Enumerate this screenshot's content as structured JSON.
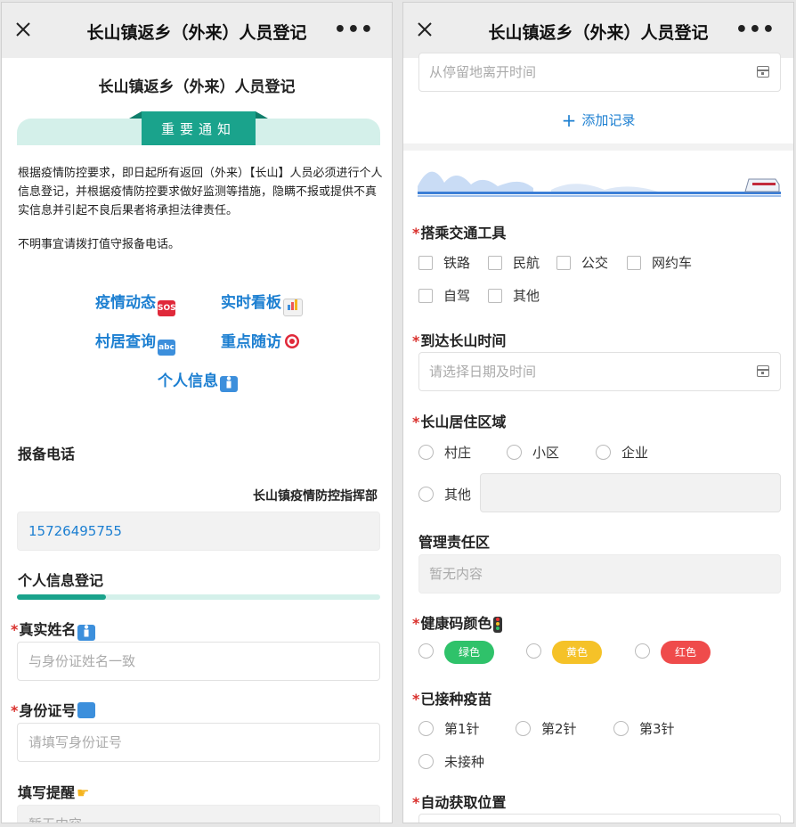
{
  "left": {
    "window_title": "长山镇返乡（外来）人员登记",
    "form_title": "长山镇返乡（外来）人员登记",
    "notice_tab": "重要通知",
    "notice_p1": "根据疫情防控要求，即日起所有返回（外来）【长山】人员必须进行个人信息登记，并根据疫情防控要求做好监测等措施，隐瞒不报或提供不真实信息并引起不良后果者将承担法律责任。",
    "notice_p2": "不明事宜请拨打值守报备电话。",
    "links": {
      "epidemic": "疫情动态",
      "realtime": "实时看板",
      "village": "村居查询",
      "followup": "重点随访",
      "personal": "个人信息"
    },
    "emoji": {
      "sos": "SOS",
      "chart": "",
      "abc": "abc",
      "target": "",
      "person": ""
    },
    "report_phone_label": "报备电话",
    "hq_name": "长山镇疫情防控指挥部",
    "phone": "15726495755",
    "section_title": "个人信息登记",
    "name_label": "真实姓名",
    "name_placeholder": "与身份证姓名一致",
    "id_label": "身份证号",
    "id_placeholder": "请填写身份证号",
    "reminder_label": "填写提醒",
    "reminder_placeholder": "暂无内容"
  },
  "right": {
    "window_title": "长山镇返乡（外来）人员登记",
    "leave_time_placeholder": "从停留地离开时间",
    "add_record": "添加记录",
    "transport_label": "搭乘交通工具",
    "transport_options": [
      "铁路",
      "民航",
      "公交",
      "网约车",
      "自驾",
      "其他"
    ],
    "arrive_label": "到达长山时间",
    "arrive_placeholder": "请选择日期及时间",
    "area_label": "长山居住区域",
    "area_options": [
      "村庄",
      "小区",
      "企业",
      "其他"
    ],
    "mgmt_label": "管理责任区",
    "mgmt_placeholder": "暂无内容",
    "health_label": "健康码颜色",
    "health_options": [
      "绿色",
      "黄色",
      "红色"
    ],
    "vaccine_label": "已接种疫苗",
    "vaccine_options": [
      "第1针",
      "第2针",
      "第3针",
      "未接种"
    ],
    "location_label": "自动获取位置"
  },
  "colors": {
    "accent": "#1aa38c",
    "link": "#1c7fd1",
    "required": "#d9302c",
    "green": "#2fc26a",
    "yellow": "#f5c228",
    "red": "#ef4b4b"
  }
}
